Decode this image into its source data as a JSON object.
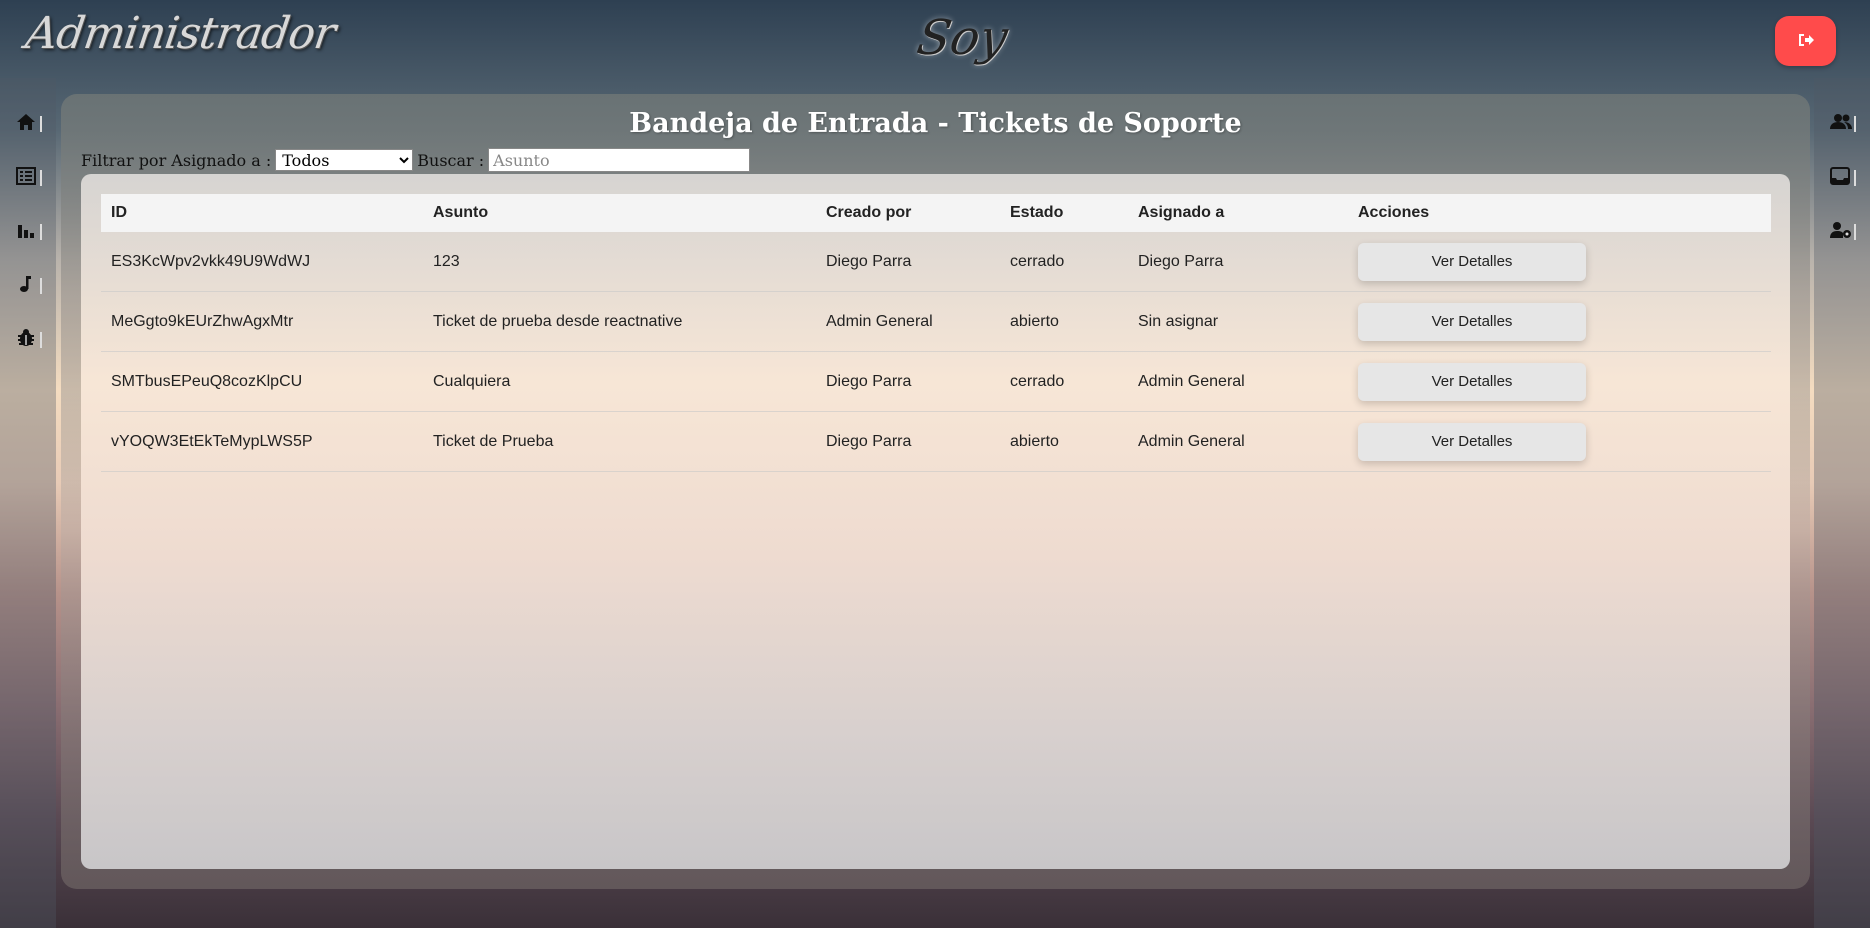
{
  "header": {
    "brand_left": "Administrador",
    "brand_center": "Soy",
    "logout_icon": "sign-out-icon"
  },
  "sidebar_left": [
    {
      "icon": "home-icon"
    },
    {
      "icon": "list-icon"
    },
    {
      "icon": "bar-chart-icon"
    },
    {
      "icon": "music-icon"
    },
    {
      "icon": "bug-icon"
    }
  ],
  "sidebar_right": [
    {
      "icon": "users-icon"
    },
    {
      "icon": "inbox-icon"
    },
    {
      "icon": "user-gear-icon"
    }
  ],
  "page": {
    "title": "Bandeja de Entrada - Tickets de Soporte",
    "filter_label": "Filtrar por Asignado a :",
    "filter_value": "Todos",
    "search_label": "Buscar :",
    "search_placeholder": "Asunto"
  },
  "table": {
    "headers": [
      "ID",
      "Asunto",
      "Creado por",
      "Estado",
      "Asignado a",
      "Acciones"
    ],
    "rows": [
      {
        "id": "ES3KcWpv2vkk49U9WdWJ",
        "asunto": "123",
        "creado": "Diego Parra",
        "estado": "cerrado",
        "asignado": "Diego Parra",
        "accion": "Ver Detalles"
      },
      {
        "id": "MeGgto9kEUrZhwAgxMtr",
        "asunto": "Ticket de prueba desde reactnative",
        "creado": "Admin General",
        "estado": "abierto",
        "asignado": "Sin asignar",
        "accion": "Ver Detalles"
      },
      {
        "id": "SMTbusEPeuQ8cozKlpCU",
        "asunto": "Cualquiera",
        "creado": "Diego Parra",
        "estado": "cerrado",
        "asignado": "Admin General",
        "accion": "Ver Detalles"
      },
      {
        "id": "vYOQW3EtEkTeMypLWS5P",
        "asunto": "Ticket de Prueba",
        "creado": "Diego Parra",
        "estado": "abierto",
        "asignado": "Admin General",
        "accion": "Ver Detalles"
      }
    ]
  }
}
